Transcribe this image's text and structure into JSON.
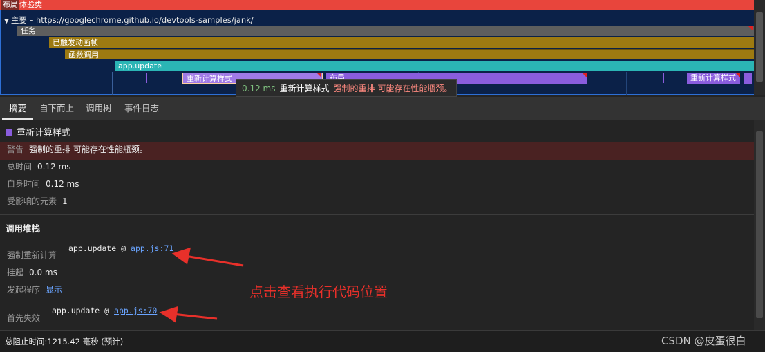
{
  "flame": {
    "experience_tag": "布局",
    "experience_label": "体验类",
    "main_label": "主要 – https://googlechrome.github.io/devtools-samples/jank/",
    "task_label": "任务",
    "anim_label": "已触发动画帧",
    "func_label": "函数调用",
    "app_label": "app.update",
    "recalc_label": "重新计算样式",
    "layout_label": "布局",
    "recalc_label_2": "重新计算样式"
  },
  "tooltip": {
    "duration": "0.12 ms",
    "name": "重新计算样式",
    "warning": "强制的重排 可能存在性能瓶颈。"
  },
  "tabs": [
    "摘要",
    "自下而上",
    "调用树",
    "事件日志"
  ],
  "summary": {
    "title": "重新计算样式",
    "warning_key": "警告",
    "warning_value": "强制的重排 可能存在性能瓶颈。",
    "total_time_key": "总时间",
    "total_time_value": "0.12 ms",
    "self_time_key": "自身时间",
    "self_time_value": "0.12 ms",
    "affected_key": "受影响的元素",
    "affected_value": "1"
  },
  "callstack": {
    "title": "调用堆栈",
    "forced_recalc_key": "强制重新计算",
    "forced_fn": "app.update @ ",
    "forced_link": "app.js:71",
    "pending_key": "挂起",
    "pending_value": "0.0 ms",
    "initiator_key": "发起程序",
    "initiator_link": "显示",
    "first_invalid_key": "首先失效",
    "first_fn": "app.update @ ",
    "first_link": "app.js:70"
  },
  "annotation": "点击查看执行代码位置",
  "footer": "总阻止时间:1215.42 毫秒 (预计)",
  "watermark": "CSDN @皮蛋很白",
  "colors": {
    "recalc": "#8a5ddd",
    "anim": "#9d7a11",
    "app": "#2bb5b5",
    "warning_bg": "#4a2222",
    "annotation": "#e8302a"
  }
}
